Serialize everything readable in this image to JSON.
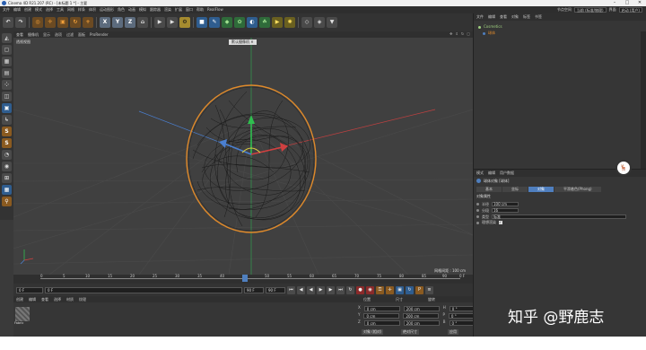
{
  "window": {
    "title": "Cinema 4D R21.207 (RC) - [未标题 1 *] - 主要",
    "controls": [
      "–",
      "□",
      "✕"
    ]
  },
  "menubar": {
    "items": [
      "文件",
      "编辑",
      "创建",
      "模式",
      "选择",
      "工具",
      "网格",
      "样条",
      "体积",
      "运动图形",
      "角色",
      "动画",
      "模拟",
      "跟踪器",
      "渲染",
      "扩展",
      "窗口",
      "帮助",
      "RealFlow"
    ],
    "interface_label": "界面",
    "interface_value": "启动 (用户)",
    "node_label": "节点空间",
    "node_value": "当前 (标准/物理)"
  },
  "toolbar": {
    "axis_buttons": [
      "X",
      "Y",
      "Z"
    ]
  },
  "viewport": {
    "menu": [
      "查看",
      "摄像机",
      "显示",
      "选项",
      "过滤",
      "面板",
      "ProRender"
    ],
    "view_name": "透视视图",
    "camera": "默认摄像机 ✕",
    "grid_spacing": "网格间距 : 100 cm"
  },
  "timeline": {
    "ticks": [
      "0",
      "5",
      "10",
      "15",
      "20",
      "25",
      "30",
      "35",
      "40",
      "45",
      "50",
      "55",
      "60",
      "65",
      "70",
      "75",
      "80",
      "85",
      "90"
    ],
    "end_label": "0 F"
  },
  "playbar": {
    "current": "0 F",
    "start": "0 F",
    "end": "90 F",
    "max": "90 F"
  },
  "materials": {
    "tabs": [
      "创建",
      "编辑",
      "查看",
      "选择",
      "材质",
      "纹理"
    ],
    "item_label": "Fabric"
  },
  "coordinates": {
    "headers": [
      "位置",
      "尺寸",
      "旋转"
    ],
    "rows": [
      {
        "axis": "X",
        "pos": "0 cm",
        "size": "200 cm",
        "rot_axis": "H",
        "rot": "0 °"
      },
      {
        "axis": "Y",
        "pos": "0 cm",
        "size": "200 cm",
        "rot_axis": "P",
        "rot": "0 °"
      },
      {
        "axis": "Z",
        "pos": "0 cm",
        "size": "200 cm",
        "rot_axis": "B",
        "rot": "0 °"
      }
    ],
    "mode_object": "对象 (相对)",
    "mode_size": "绝对尺寸",
    "apply": "应用"
  },
  "object_manager": {
    "menu": [
      "文件",
      "编辑",
      "查看",
      "对象",
      "标签",
      "书签"
    ],
    "objects": [
      "Cosmetics",
      "球体"
    ]
  },
  "attributes": {
    "menu": [
      "模式",
      "编辑",
      "用户数据"
    ],
    "title": "球体对象 [球体]",
    "tabs": [
      "基本",
      "坐标",
      "对象",
      "平滑着色(Phong)"
    ],
    "active_tab": "对象",
    "section": "对象属性",
    "rows": [
      {
        "label": "半径",
        "value": "100 cm"
      },
      {
        "label": "分段",
        "value": "16"
      },
      {
        "label": "类型",
        "value": "标准"
      },
      {
        "label": "理想渲染",
        "value": "✓"
      }
    ]
  },
  "watermark": "知乎 @野鹿志",
  "colors": {
    "accent": "#4f7fbf",
    "selection_orange": "#e08a2a",
    "axis_y": "#2fbf4f",
    "axis_x": "#d04040",
    "axis_z": "#4a7fd0"
  }
}
